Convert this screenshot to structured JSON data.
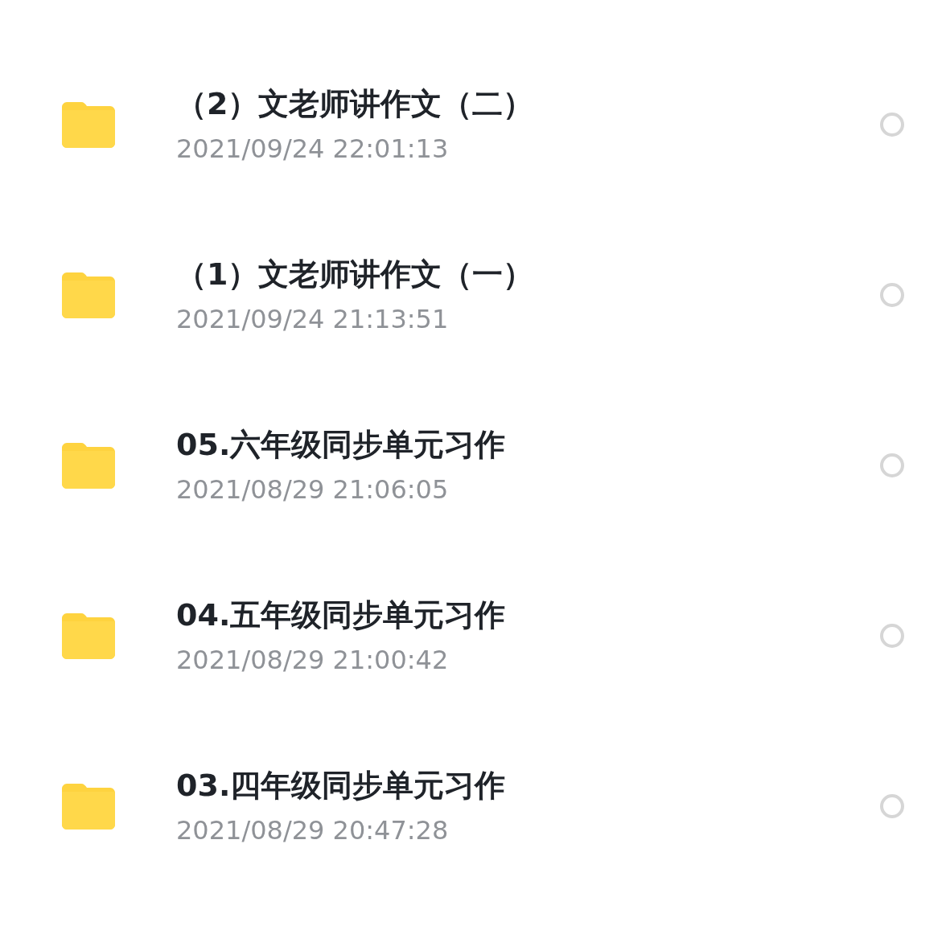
{
  "files": [
    {
      "name": "（2）文老师讲作文（二）",
      "date": "2021/09/24 22:01:13",
      "selected": false
    },
    {
      "name": "（1）文老师讲作文（一）",
      "date": "2021/09/24 21:13:51",
      "selected": false
    },
    {
      "name": "05.六年级同步单元习作",
      "date": "2021/08/29 21:06:05",
      "selected": false
    },
    {
      "name": "04.五年级同步单元习作",
      "date": "2021/08/29 21:00:42",
      "selected": false
    },
    {
      "name": "03.四年级同步单元习作",
      "date": "2021/08/29 20:47:28",
      "selected": false
    }
  ]
}
